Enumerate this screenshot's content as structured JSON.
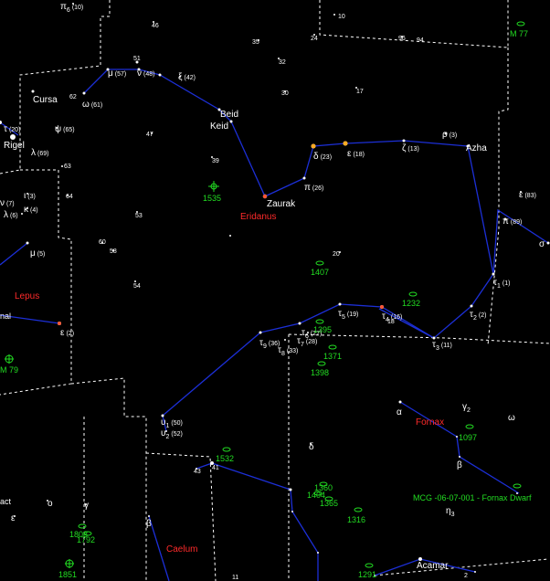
{
  "colors": {
    "background": "#000000",
    "constellation_lines": "#1c2fd6",
    "boundaries": "#ffffff",
    "star_labels": "#ffffff",
    "constellation_names": "#ff2a2a",
    "deep_sky": "#22dd22",
    "highlight_star": "#ffaa22"
  },
  "constellations": {
    "eridanus": "Eridanus",
    "lepus": "Lepus",
    "fornax": "Fornax",
    "caelum": "Caelum"
  },
  "stars": {
    "pi6": "π",
    "pi6_sub": "6",
    "pi6_num": "(10)",
    "n46": "46",
    "n10": "10",
    "n35": "35",
    "n32": "32",
    "n24": "24",
    "n96": "96",
    "n94": "94",
    "mu": "μ",
    "mu_num": "(57)",
    "n51": "51",
    "nu": "ν",
    "nu_num": "(48)",
    "xi": "ξ",
    "xi_num": "(42)",
    "n30": "30",
    "n17": "17",
    "cursa": "Cursa",
    "n62": "62",
    "omega": "ω",
    "omega_num": "(61)",
    "beid": "Beid",
    "keid": "Keid",
    "n47": "47",
    "tau": "τ",
    "tau_num": "(20)",
    "rigel": "Rigel",
    "psi": "ψ",
    "psi_num": "(65)",
    "lambda": "λ",
    "lambda_num": "(69)",
    "n39": "39",
    "n63": "63",
    "n64": "64",
    "zaurak": "Zaurak",
    "delta": "δ",
    "delta_num": "(23)",
    "eps18": "ε",
    "eps18_num": "(18)",
    "zeta": "ζ",
    "zeta_num": "(13)",
    "rho": "ρ",
    "rho_num": "(3)",
    "azha": "Azha",
    "pi26": "π",
    "pi26_num": "(26)",
    "eps83": "ε",
    "eps83_num": "(83)",
    "pi89": "π",
    "pi89_num": "(89)",
    "nu7": "ν",
    "nu7_num": "(7)",
    "kappa": "κ",
    "kappa_num": "(4)",
    "iota": "ι",
    "iota_num": "(3)",
    "lambda6": "λ",
    "lambda6_num": "(6)",
    "n53": "53",
    "mu5": "μ",
    "mu5_num": "(5)",
    "n60": "60",
    "n58": "58",
    "n20": "20",
    "sigma": "σ",
    "n54": "54",
    "tau1": "τ",
    "tau1_sub": "1",
    "tau1_num": "(1)",
    "tau5": "τ",
    "tau5_sub": "5",
    "tau5_num": "(19)",
    "tau4": "τ",
    "tau4_sub": "4",
    "tau4_num": "(16)",
    "tau2": "τ",
    "tau2_sub": "2",
    "tau2_num": "(2)",
    "tau6": "τ",
    "tau6_sub": "6",
    "tau6_num": "(27)",
    "tau7": "τ",
    "tau7_sub": "7",
    "tau7_num": "(28)",
    "tau9": "τ",
    "tau9_sub": "9",
    "tau9_num": "(36)",
    "tau8": "τ",
    "tau8_sub": "8",
    "tau8_num": "(33)",
    "tau3": "τ",
    "tau3_sub": "3",
    "tau3_num": "(11)",
    "eps2": "ε",
    "eps2_num": "(2)",
    "nal": "nal",
    "n18": "18",
    "alpha": "α",
    "gamma2": "γ",
    "gamma2_sub": "2",
    "omega_f": "ω",
    "upsilon1": "υ",
    "upsilon1_sub": "1",
    "upsilon1_num": "(50)",
    "upsilon2": "υ",
    "upsilon2_sub": "2",
    "upsilon2_num": "(52)",
    "delta_s": "δ",
    "beta_f": "β",
    "n41": "41",
    "n43": "43",
    "eta3": "η",
    "eta3_sub": "3",
    "act": "act",
    "omicron": "ο",
    "gamma_c": "γ",
    "epsilon_c": "ε",
    "beta_c": "β",
    "achernar": "Acamar",
    "n11": "11",
    "n2": "2"
  },
  "deep_sky": {
    "m77": "M 77",
    "m79": "M 79",
    "ngc1535": "1535",
    "ngc1407": "1407",
    "ngc1232": "1232",
    "ngc1395": "1395",
    "ngc1371": "1371",
    "ngc1398": "1398",
    "ngc1097": "1097",
    "ngc1532": "1532",
    "ngc1360": "1360",
    "ngc1404": "1404",
    "ngc1365": "1365",
    "ngc1316": "1316",
    "ngc1808": "1808",
    "ngc1792": "1792",
    "ngc1851": "1851",
    "ngc1291": "1291",
    "fornax_dwarf": "MCG -06-07-001 - Fornax Dwarf"
  }
}
